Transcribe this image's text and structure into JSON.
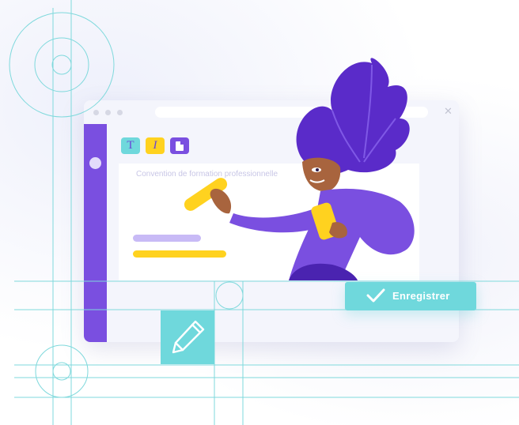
{
  "editor": {
    "document_title": "Convention de formation professionnelle",
    "tools": [
      {
        "glyph": "T",
        "icon": "text-format-icon"
      },
      {
        "glyph": "I",
        "icon": "italic-format-icon"
      },
      {
        "glyph": "",
        "icon": "document-icon"
      }
    ]
  },
  "actions": {
    "save_label": "Enregistrer",
    "save_icon": "checkmark-icon"
  },
  "colors": {
    "purple": "#7a4fe0",
    "turquoise": "#6fd8dc",
    "yellow": "#ffd21f",
    "lavender": "#c8baf6"
  }
}
